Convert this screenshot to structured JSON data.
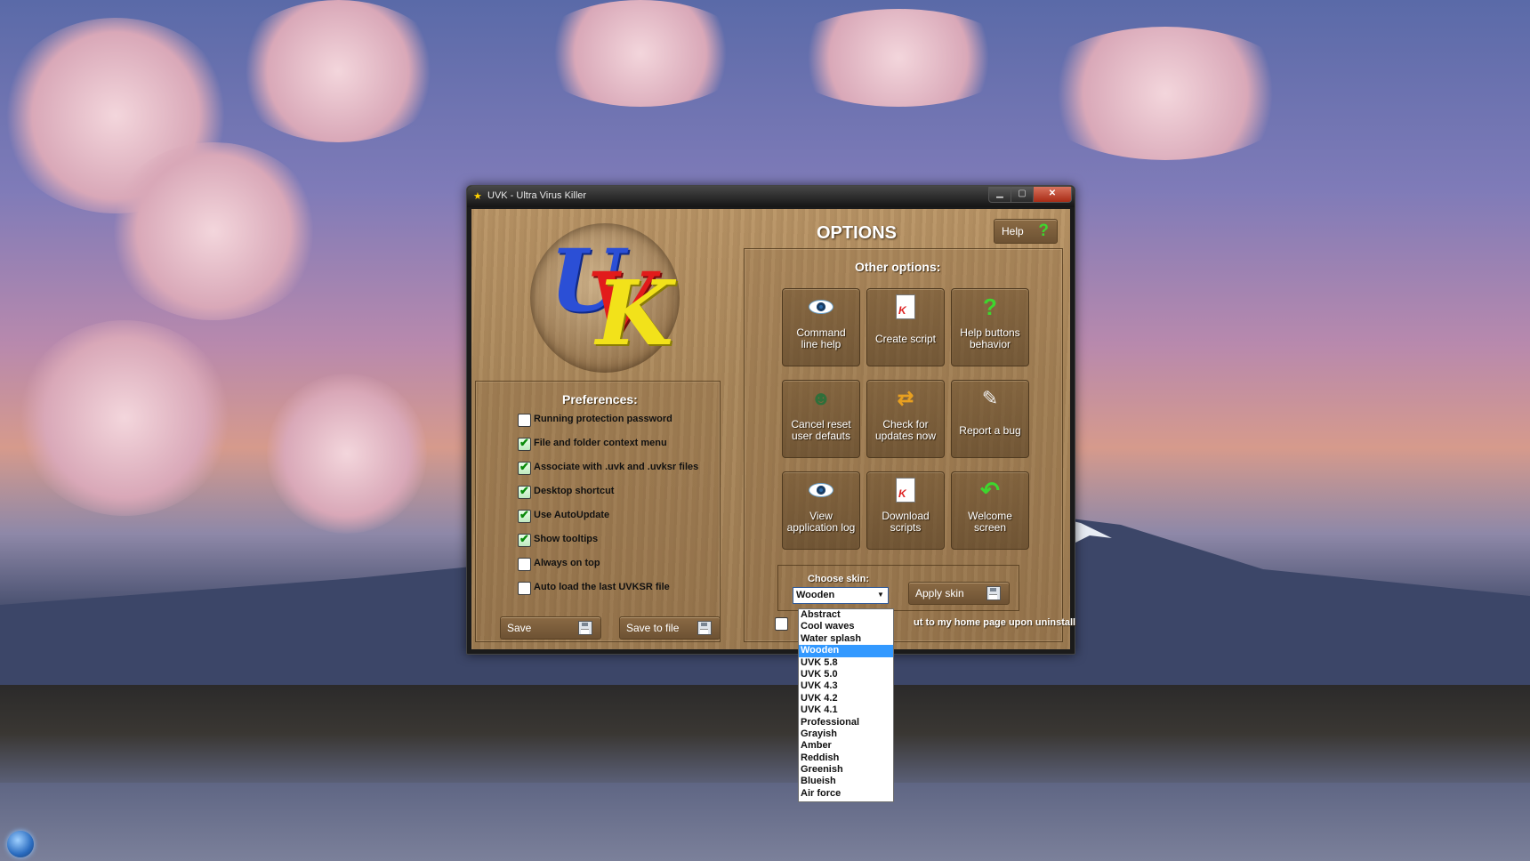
{
  "window": {
    "title": "UVK - Ultra Virus Killer",
    "min_glyph": "▁",
    "max_glyph": "▢",
    "close_glyph": "✕"
  },
  "header": {
    "title": "OPTIONS",
    "help_label": "Help",
    "help_glyph": "?"
  },
  "logo": {
    "letters": [
      "U",
      "V",
      "K"
    ]
  },
  "preferences": {
    "title": "Preferences:",
    "items": [
      {
        "label": "Running protection password",
        "checked": false
      },
      {
        "label": "File and folder context menu",
        "checked": true
      },
      {
        "label": "Associate with .uvk and .uvksr files",
        "checked": true
      },
      {
        "label": "Desktop shortcut",
        "checked": true
      },
      {
        "label": "Use AutoUpdate",
        "checked": true
      },
      {
        "label": "Show tooltips",
        "checked": true
      },
      {
        "label": "Always on top",
        "checked": false
      },
      {
        "label": "Auto load the last UVKSR file",
        "checked": false
      }
    ],
    "save_label": "Save",
    "save_to_file_label": "Save to file"
  },
  "other_options": {
    "title": "Other options:",
    "tiles": [
      {
        "line1": "Command",
        "line2": "line help",
        "icon": "eye-icon"
      },
      {
        "line1": "Create script",
        "line2": "",
        "icon": "script-icon"
      },
      {
        "line1": "Help buttons",
        "line2": "behavior",
        "icon": "question-icon"
      },
      {
        "line1": "Cancel reset",
        "line2": "user defauts",
        "icon": "user-reset-icon"
      },
      {
        "line1": "Check for",
        "line2": "updates now",
        "icon": "update-icon"
      },
      {
        "line1": "Report a bug",
        "line2": "",
        "icon": "notepad-icon"
      },
      {
        "line1": "View",
        "line2": "application log",
        "icon": "eye-icon"
      },
      {
        "line1": "Download",
        "line2": "scripts",
        "icon": "script-icon"
      },
      {
        "line1": "Welcome",
        "line2": "screen",
        "icon": "back-arrow-icon"
      }
    ],
    "skin": {
      "label": "Choose skin:",
      "selected": "Wooden",
      "apply_label": "Apply skin",
      "options": [
        "Abstract",
        "Cool waves",
        "Water splash",
        "Wooden",
        "UVK 5.8",
        "UVK 5.0",
        "UVK 4.3",
        "UVK 4.2",
        "UVK 4.1",
        "Professional",
        "Grayish",
        "Amber",
        "Reddish",
        "Greenish",
        "Blueish",
        "Air force"
      ]
    },
    "uninstall_text": "ut to my home page upon uninstall"
  },
  "colors": {
    "accent_green": "#3ed62e",
    "selection_blue": "#3399ff",
    "wood": "#a9875b"
  }
}
